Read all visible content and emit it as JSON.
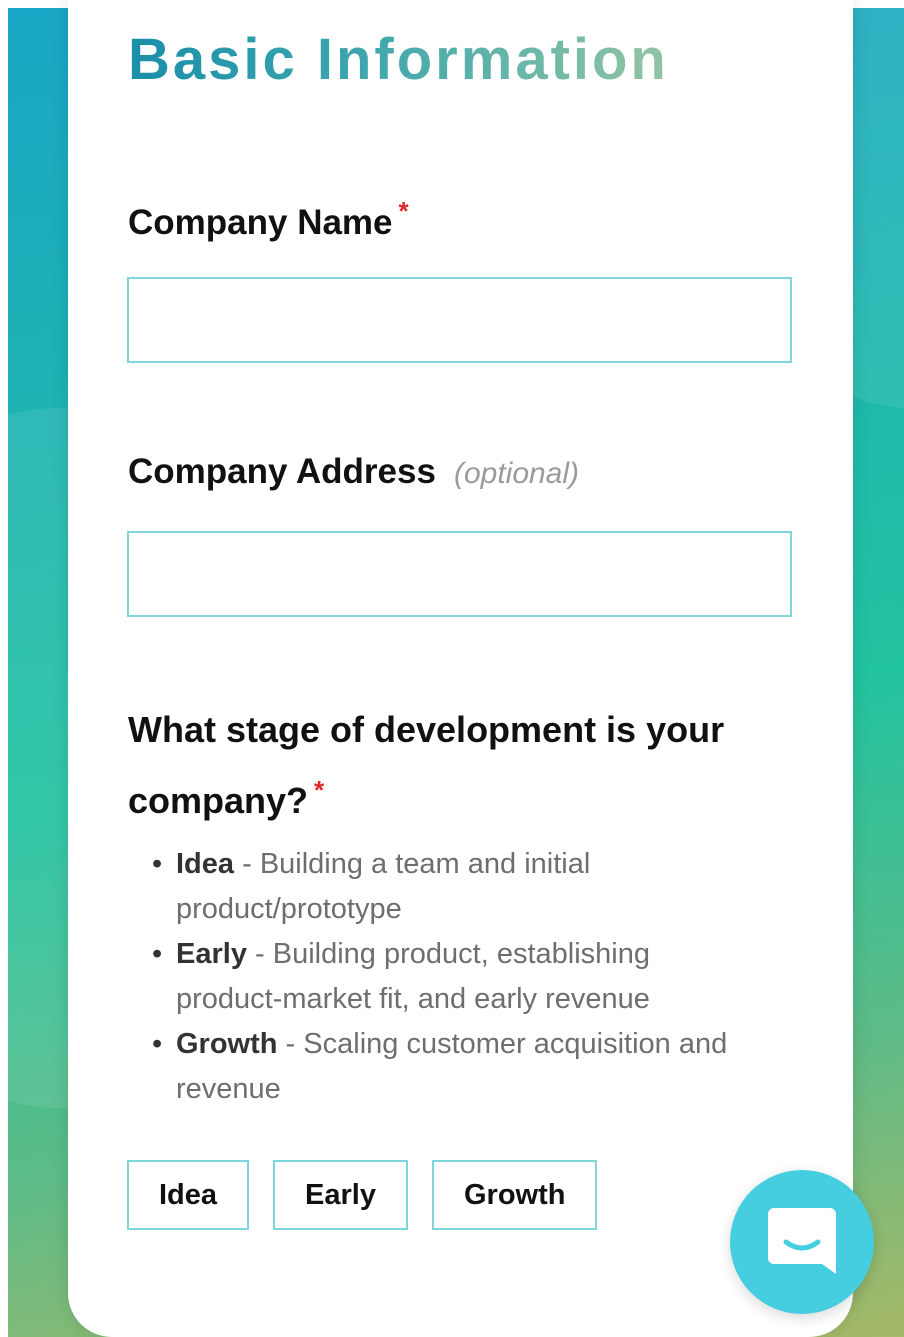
{
  "form": {
    "title": "Basic Information",
    "required_marker": "*",
    "company_name": {
      "label": "Company Name",
      "value": "",
      "placeholder": ""
    },
    "company_address": {
      "label": "Company Address",
      "optional_note": "(optional)",
      "value": "",
      "placeholder": ""
    },
    "stage_question": {
      "label": "What stage of development is your company?",
      "stages": [
        {
          "name": "Idea",
          "separator": " - ",
          "description": "Building a team and initial product/prototype"
        },
        {
          "name": "Early",
          "separator": " - ",
          "description": "Building product, establishing product-market fit, and early revenue"
        },
        {
          "name": "Growth",
          "separator": " - ",
          "description": "Scaling customer acquisition and revenue"
        }
      ],
      "options": [
        "Idea",
        "Early",
        "Growth"
      ]
    }
  },
  "colors": {
    "accent_border": "#7fd6dc",
    "required_star": "#e0262b",
    "chat_button": "#45cde0",
    "title_gradient_start": "#1a8fa9",
    "title_gradient_end": "#93c4a3"
  },
  "chat": {
    "icon": "chat-bubble-icon"
  }
}
